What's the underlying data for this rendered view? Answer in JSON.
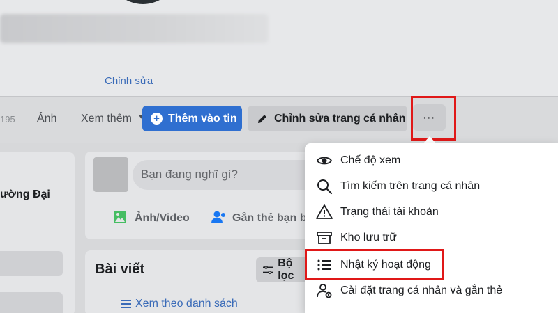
{
  "profile": {
    "edit_label": "Chỉnh sửa",
    "left_partial_text": "ường Đại"
  },
  "tabs": {
    "partial_count": "195",
    "photos": "Ảnh",
    "more": "Xem thêm"
  },
  "actions": {
    "add_story": "Thêm vào tin",
    "edit_profile": "Chỉnh sửa trang cá nhân",
    "more": "···"
  },
  "composer": {
    "placeholder": "Bạn đang nghĩ gì?",
    "photo_video": "Ảnh/Video",
    "tag_friends": "Gắn thẻ bạn bè"
  },
  "posts": {
    "title": "Bài viết",
    "filter": "Bộ lọc",
    "list_view": "Xem theo danh sách"
  },
  "menu": {
    "items": [
      {
        "label": "Chế độ xem",
        "icon": "eye-icon"
      },
      {
        "label": "Tìm kiếm trên trang cá nhân",
        "icon": "search-icon"
      },
      {
        "label": "Trạng thái tài khoản",
        "icon": "warning-icon"
      },
      {
        "label": "Kho lưu trữ",
        "icon": "archive-icon"
      },
      {
        "label": "Nhật ký hoạt động",
        "icon": "list-icon"
      },
      {
        "label": "Cài đặt trang cá nhân và gắn thẻ",
        "icon": "profile-settings-icon"
      }
    ]
  },
  "colors": {
    "primary": "#2f6fd0",
    "highlight_box": "#e01818",
    "link": "#3a6bb8"
  }
}
